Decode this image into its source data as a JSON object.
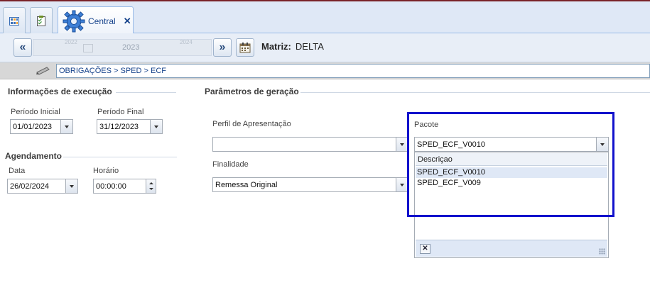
{
  "tabs": {
    "central_label": "Central",
    "close_glyph": "✕"
  },
  "navbar": {
    "prev_glyph": "«",
    "next_glyph": "»",
    "year_prev": "2022",
    "year_current": "2023",
    "year_next": "2024",
    "matriz_label": "Matriz:",
    "matriz_value": "DELTA"
  },
  "breadcrumb": {
    "path": "OBRIGAÇÕES > SPED > ECF"
  },
  "execucao": {
    "heading": "Informações de execução",
    "periodo_inicial_label": "Período  Inicial",
    "periodo_inicial_value": "01/01/2023",
    "periodo_final_label": "Período Final",
    "periodo_final_value": "31/12/2023"
  },
  "agendamento": {
    "heading": "Agendamento",
    "data_label": "Data",
    "data_value": "26/02/2024",
    "horario_label": "Horário",
    "horario_value": "00:00:00"
  },
  "parametros": {
    "heading": "Parâmetros de geração",
    "perfil_label": "Perfil de Apresentação",
    "perfil_value": "",
    "finalidade_label": "Finalidade",
    "finalidade_value": "Remessa Original",
    "pacote_label": "Pacote",
    "pacote_value": "SPED_ECF_V0010"
  },
  "pacote_dropdown": {
    "column_header": "Descriçao",
    "options": [
      "SPED_ECF_V0010",
      "SPED_ECF_V009"
    ],
    "selected_index": 0,
    "close_glyph": "✕"
  },
  "colors": {
    "highlight_border": "#1111cc",
    "accent": "#15428b"
  }
}
